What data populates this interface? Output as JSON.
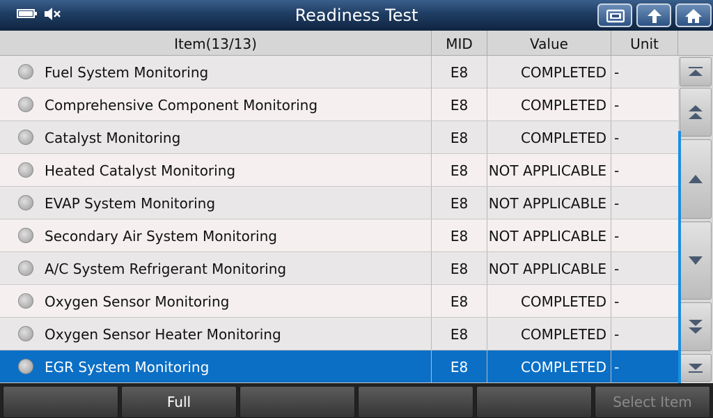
{
  "title": "Readiness Test",
  "status_icons": [
    "battery-icon",
    "speaker-muted-icon"
  ],
  "toolbar": [
    "screenshot-icon",
    "back-icon",
    "home-icon"
  ],
  "table": {
    "headers": {
      "item": "Item(13/13)",
      "mid": "MID",
      "value": "Value",
      "unit": "Unit"
    },
    "rows": [
      {
        "item": "Fuel System Monitoring",
        "mid": "E8",
        "value": "COMPLETED",
        "unit": "-"
      },
      {
        "item": "Comprehensive Component Monitoring",
        "mid": "E8",
        "value": "COMPLETED",
        "unit": "-"
      },
      {
        "item": "Catalyst Monitoring",
        "mid": "E8",
        "value": "COMPLETED",
        "unit": "-"
      },
      {
        "item": "Heated Catalyst Monitoring",
        "mid": "E8",
        "value": "NOT APPLICABLE",
        "unit": "-"
      },
      {
        "item": "EVAP System Monitoring",
        "mid": "E8",
        "value": "NOT APPLICABLE",
        "unit": "-"
      },
      {
        "item": "Secondary Air System Monitoring",
        "mid": "E8",
        "value": "NOT APPLICABLE",
        "unit": "-"
      },
      {
        "item": "A/C System Refrigerant Monitoring",
        "mid": "E8",
        "value": "NOT APPLICABLE",
        "unit": "-"
      },
      {
        "item": "Oxygen Sensor Monitoring",
        "mid": "E8",
        "value": "COMPLETED",
        "unit": "-"
      },
      {
        "item": "Oxygen Sensor Heater Monitoring",
        "mid": "E8",
        "value": "COMPLETED",
        "unit": "-"
      },
      {
        "item": "EGR System Monitoring",
        "mid": "E8",
        "value": "COMPLETED",
        "unit": "-"
      }
    ],
    "selected_index": 9
  },
  "scroll_buttons": [
    "scroll-top-icon",
    "page-up-icon",
    "scroll-up-icon",
    "scroll-down-icon",
    "page-down-icon",
    "scroll-bottom-icon"
  ],
  "footer": {
    "buttons": [
      "",
      "Full",
      "",
      "",
      "",
      "Select Item"
    ],
    "disabled": [
      false,
      false,
      false,
      false,
      false,
      true
    ]
  },
  "colors": {
    "title_bar": "#1f3d63",
    "selected_row": "#0b6fc5",
    "scroll_indicator": "#1a8fe0"
  }
}
